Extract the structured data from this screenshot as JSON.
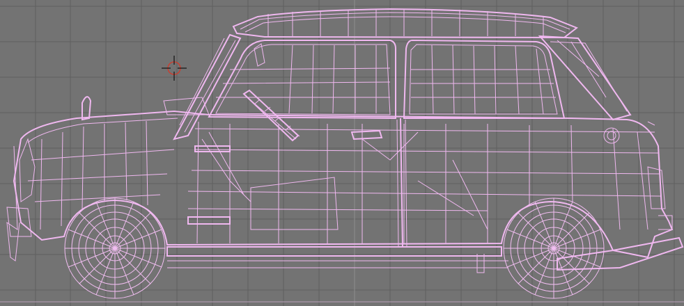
{
  "viewport": {
    "view_type": "side-orthographic-wireframe",
    "background_color": "#737373",
    "grid_color": "#5f5f5f",
    "wireframe_color": "#f0b8f0",
    "cursor_color": "#d23a2a",
    "object": "car-body-wireframe",
    "icons": [
      "3d-cursor-icon"
    ]
  }
}
